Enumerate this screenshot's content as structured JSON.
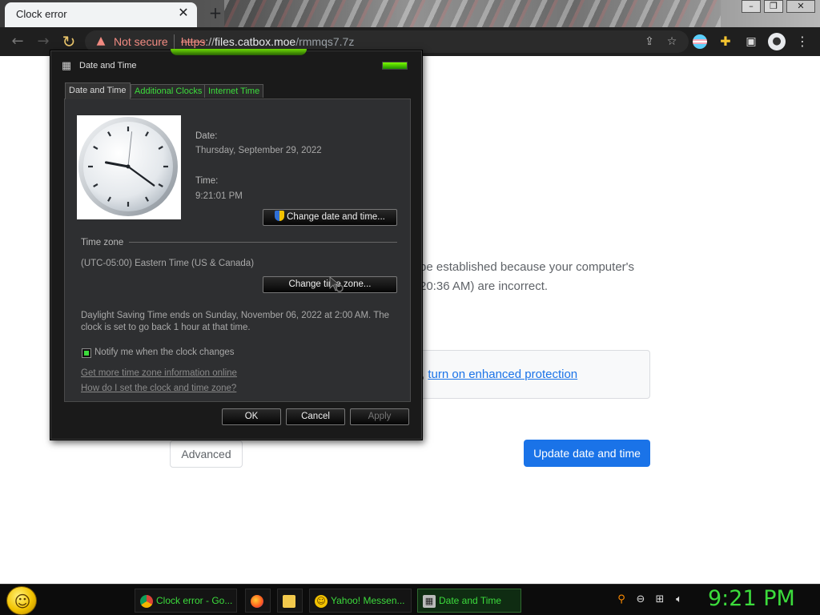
{
  "browser": {
    "tab_title": "Clock error",
    "tab_close": "✕",
    "new_tab": "+",
    "window_controls": [
      "–",
      "❐",
      "✕"
    ],
    "security_label": "Not secure",
    "url": {
      "scheme": "https",
      "separator": "://",
      "host": "files.catbox.moe",
      "path": "/rmmqs7.7z"
    }
  },
  "page": {
    "error_text_line1": "be established because your computer's",
    "error_text_line2": "20:36 AM) are incorrect.",
    "info_prefix": ", ",
    "info_link": "turn on enhanced protection",
    "advanced_button": "Advanced",
    "update_button": "Update date and time"
  },
  "dialog": {
    "title": "Date and Time",
    "tabs": [
      "Date and Time",
      "Additional Clocks",
      "Internet Time"
    ],
    "date_label": "Date:",
    "date_value": "Thursday, September 29, 2022",
    "time_label": "Time:",
    "time_value": "9:21:01 PM",
    "change_datetime_button": "Change date and time...",
    "timezone_heading": "Time zone",
    "timezone_value": "(UTC-05:00) Eastern Time (US & Canada)",
    "change_timezone_button": "Change time zone...",
    "dst_text": "Daylight Saving Time ends on Sunday, November 06, 2022 at 2:00 AM. The clock is set to go back 1 hour at that time.",
    "notify_label": "Notify me when the clock changes",
    "notify_checked": true,
    "link_timezone_info": "Get more time zone information online",
    "link_how_to": "How do I set the clock and time zone?",
    "ok_button": "OK",
    "cancel_button": "Cancel",
    "apply_button": "Apply"
  },
  "taskbar": {
    "items": [
      {
        "label": "Clock error - Go...",
        "icon": "chrome-icon"
      },
      {
        "label": "Yahoo! Messen...",
        "icon": "yahoo-messenger-icon"
      },
      {
        "label": "Date and Time",
        "icon": "date-time-icon"
      }
    ],
    "clock": "9:21 PM"
  },
  "colors": {
    "accent_green": "#3cdc3c",
    "chrome_blue": "#1a73e8",
    "warning_red": "#f28b82"
  }
}
